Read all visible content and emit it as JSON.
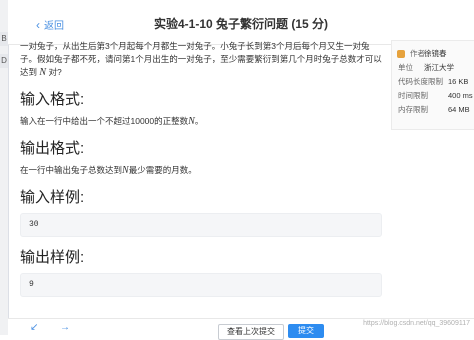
{
  "left_tabs": [
    "B",
    "D"
  ],
  "header": {
    "back_label": "返回",
    "title": "实验4-1-10 兔子繁衍问题 (15 分)"
  },
  "problem": {
    "description_1": "一对兔子，从出生后第3个月起每个月都生一对兔子。小兔子长到第3个月后每个月又生一对兔子。假如兔子都不死，请问第1个月出生的一对兔子，至少需要繁衍到第几个月时兔子总数才可以达到",
    "description_var": "N",
    "description_2": "对?",
    "input_heading": "输入格式:",
    "input_text_1": "输入在一行中给出一个不超过10000的正整数",
    "input_var": "N",
    "input_text_2": "。",
    "output_heading": "输出格式:",
    "output_text_1": "在一行中输出兔子总数达到",
    "output_var": "N",
    "output_text_2": "最少需要的月数。",
    "sample_input_heading": "输入样例:",
    "sample_input": "30",
    "sample_output_heading": "输出样例:",
    "sample_output": "9"
  },
  "info": {
    "author_label": "作者",
    "author_value": "徐镜春",
    "unit_label": "单位",
    "unit_value": "浙江大学",
    "code_limit_label": "代码长度限制",
    "code_limit_value": "16 KB",
    "time_limit_label": "时间限制",
    "time_limit_value": "400 ms",
    "memory_limit_label": "内存限制",
    "memory_limit_value": "64 MB"
  },
  "footer": {
    "prev_icon": "arrow-left",
    "next_icon": "arrow-right",
    "last_submit_label": "查看上次提交",
    "submit_label": "提交",
    "watermark": "https://blog.csdn.net/qq_39609117"
  },
  "colors": {
    "accent": "#2d8cf0",
    "link": "#4a90e2",
    "author_badge": "#e6a23c"
  }
}
